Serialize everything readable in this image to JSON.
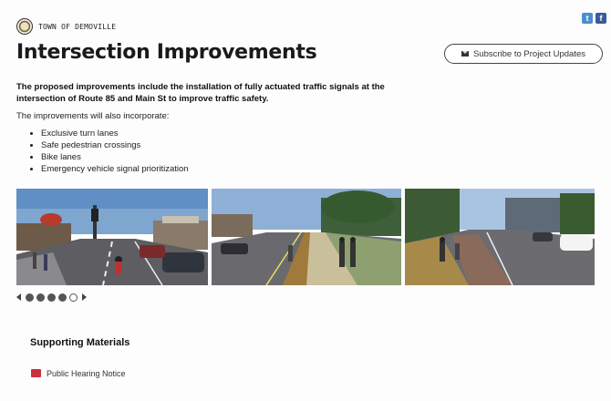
{
  "header": {
    "town_name": "TOWN OF DEMOVILLE",
    "social": {
      "twitter_glyph": "t",
      "facebook_glyph": "f"
    }
  },
  "main": {
    "title": "Intersection Improvements",
    "subscribe_label": "Subscribe to Project Updates",
    "intro": "The proposed improvements include the installation of fully actuated traffic signals at the intersection of Route 85 and Main St to improve traffic safety.",
    "incorporate_label": "The improvements will also incorporate:",
    "features": [
      "Exclusive turn lanes",
      "Safe pedestrian crossings",
      "Bike lanes",
      "Emergency vehicle signal prioritization"
    ]
  },
  "gallery": {
    "slide_count": 5,
    "active_slide": 1
  },
  "supporting": {
    "title": "Supporting Materials",
    "items": [
      {
        "label": "Public Hearing Notice",
        "icon": "pdf-icon"
      }
    ]
  },
  "colors": {
    "twitter": "#4a8fd0",
    "facebook": "#3c5a99",
    "pdf": "#c9323a"
  }
}
